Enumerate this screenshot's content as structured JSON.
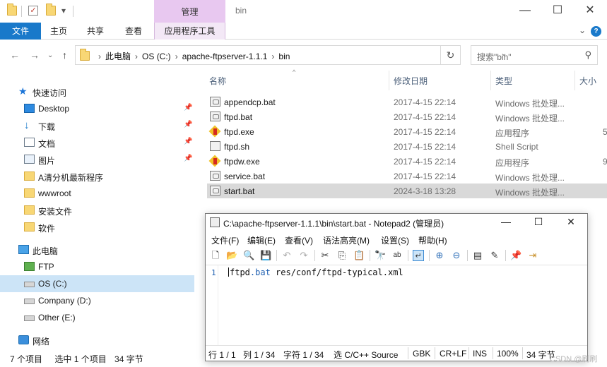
{
  "titlebar": {
    "context_group": "管理",
    "window_title": "bin",
    "minimize": "—",
    "maximize": "☐",
    "close": "✕"
  },
  "ribbon": {
    "tabs": [
      "文件",
      "主页",
      "共享",
      "查看",
      "应用程序工具"
    ],
    "expand": "⌄",
    "help": "?"
  },
  "address": {
    "crumbs": [
      "此电脑",
      "OS (C:)",
      "apache-ftpserver-1.1.1",
      "bin"
    ],
    "search_placeholder": "搜索\"bin\""
  },
  "sidebar": {
    "items": [
      {
        "label": "快速访问",
        "icon": "star-icon",
        "pinned": false
      },
      {
        "label": "Desktop",
        "icon": "desktop-icon",
        "pinned": true
      },
      {
        "label": "下载",
        "icon": "download-icon",
        "pinned": true
      },
      {
        "label": "文档",
        "icon": "document-icon",
        "pinned": true
      },
      {
        "label": "图片",
        "icon": "picture-icon",
        "pinned": true
      },
      {
        "label": "A清分机最新程序",
        "icon": "folder-icon",
        "pinned": false
      },
      {
        "label": "wwwroot",
        "icon": "folder-icon",
        "pinned": false
      },
      {
        "label": "安装文件",
        "icon": "folder-icon",
        "pinned": false
      },
      {
        "label": "软件",
        "icon": "folder-icon",
        "pinned": false
      },
      {
        "label": "此电脑",
        "icon": "pc-icon",
        "pinned": false
      },
      {
        "label": "FTP",
        "icon": "ftp-icon",
        "pinned": false
      },
      {
        "label": "OS (C:)",
        "icon": "drive-icon",
        "pinned": false,
        "selected": true
      },
      {
        "label": "Company (D:)",
        "icon": "drive-icon",
        "pinned": false
      },
      {
        "label": "Other (E:)",
        "icon": "drive-icon",
        "pinned": false
      },
      {
        "label": "网络",
        "icon": "network-icon",
        "pinned": false
      }
    ]
  },
  "file_list": {
    "columns": [
      "名称",
      "修改日期",
      "类型",
      "大小"
    ],
    "rows": [
      {
        "name": "appendcp.bat",
        "date": "2017-4-15 22:14",
        "type": "Windows 批处理...",
        "size": "",
        "icon": "bat"
      },
      {
        "name": "ftpd.bat",
        "date": "2017-4-15 22:14",
        "type": "Windows 批处理...",
        "size": "",
        "icon": "bat"
      },
      {
        "name": "ftpd.exe",
        "date": "2017-4-15 22:14",
        "type": "应用程序",
        "size": "5",
        "icon": "exe"
      },
      {
        "name": "ftpd.sh",
        "date": "2017-4-15 22:14",
        "type": "Shell Script",
        "size": "",
        "icon": "sh"
      },
      {
        "name": "ftpdw.exe",
        "date": "2017-4-15 22:14",
        "type": "应用程序",
        "size": "9",
        "icon": "exe"
      },
      {
        "name": "service.bat",
        "date": "2017-4-15 22:14",
        "type": "Windows 批处理...",
        "size": "",
        "icon": "bat"
      },
      {
        "name": "start.bat",
        "date": "2024-3-18 13:28",
        "type": "Windows 批处理...",
        "size": "",
        "icon": "bat",
        "selected": true
      }
    ]
  },
  "statusbar": {
    "item_count": "7 个项目",
    "selected": "选中 1 个项目",
    "size": "34 字节"
  },
  "notepad": {
    "title": "C:\\apache-ftpserver-1.1.1\\bin\\start.bat - Notepad2 (管理员)",
    "menu": [
      "文件(F)",
      "编辑(E)",
      "查看(V)",
      "语法高亮(M)",
      "设置(S)",
      "帮助(H)"
    ],
    "line_number": "1",
    "code_kw1": "ftpd",
    "code_kw2": ".bat",
    "code_rest": " res/conf/ftpd-typical.xml",
    "status": {
      "line": "行 1 / 1",
      "col": "列 1 / 34",
      "char": "字符 1 / 34",
      "sel_lang": "选 C/C++ Source",
      "encoding": "GBK",
      "eol": "CR+LF",
      "ins": "INS",
      "zoom": "100%",
      "size": "34 字节"
    }
  },
  "watermark": "CSDN @刷刷"
}
